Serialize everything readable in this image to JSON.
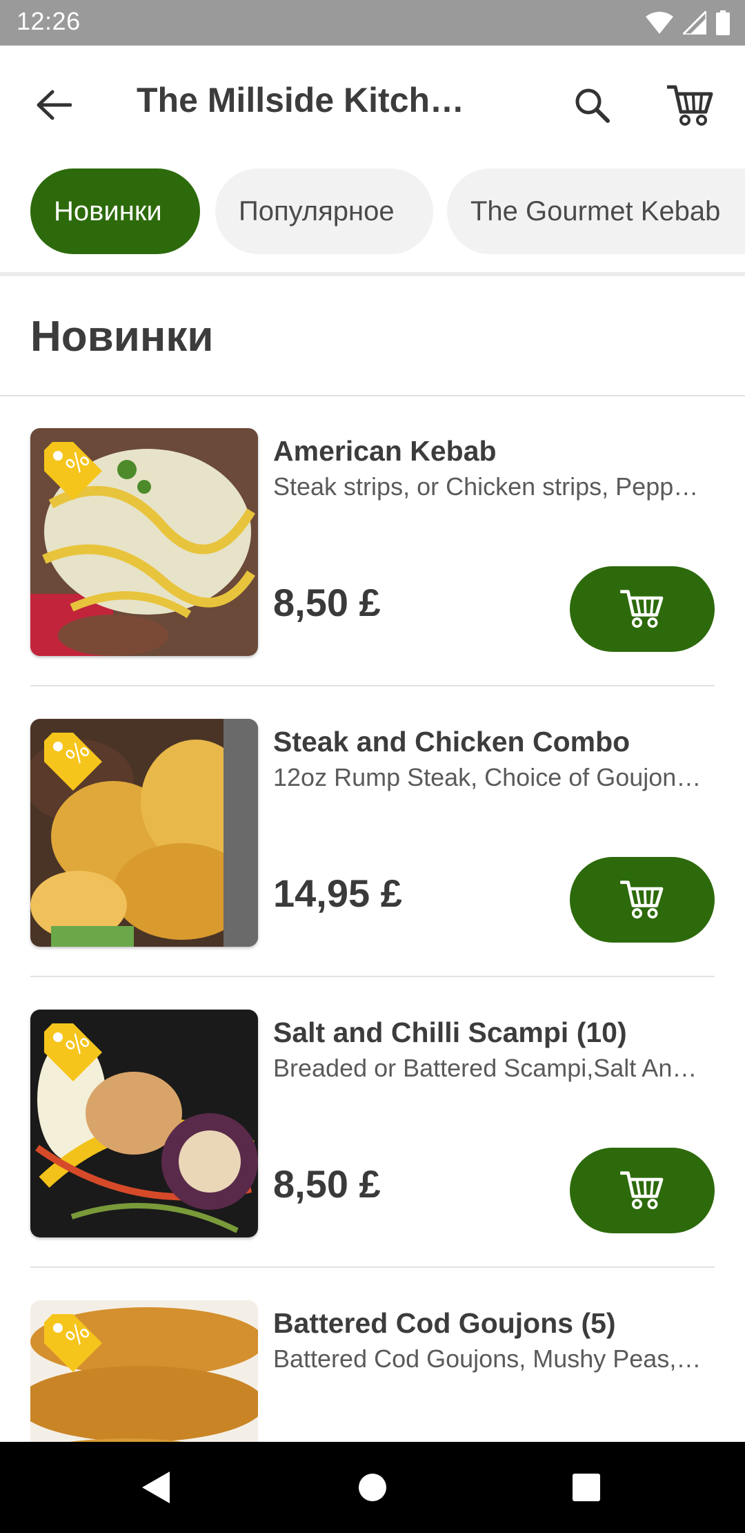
{
  "status_bar": {
    "time": "12:26"
  },
  "app_bar": {
    "title": "The Millside Kitch…"
  },
  "categories": [
    {
      "label": "Новинки",
      "active": true
    },
    {
      "label": "Популярное",
      "active": false
    },
    {
      "label": "The Gourmet  Kebab",
      "active": false
    }
  ],
  "section": {
    "title": "Новинки"
  },
  "items": [
    {
      "name": "American Kebab",
      "description": "Steak strips, or Chicken strips, Pepp…",
      "price": "8,50 £"
    },
    {
      "name": "Steak and Chicken Combo",
      "description": "12oz Rump Steak, Choice of Goujon…",
      "price": "14,95 £"
    },
    {
      "name": "Salt and Chilli  Scampi  (10)",
      "description": "Breaded or Battered Scampi,Salt An…",
      "price": "8,50 £"
    },
    {
      "name": "Battered Cod Goujons  (5)",
      "description": "Battered Cod Goujons, Mushy Peas,…",
      "price": ""
    }
  ],
  "colors": {
    "accent": "#2d6a0b",
    "status_bar": "#9a9a9a",
    "chip_inactive": "#f2f2f2",
    "tag": "#f6c51c"
  },
  "icons": [
    "back-arrow-icon",
    "search-icon",
    "cart-icon",
    "discount-tag-icon",
    "wifi-icon",
    "signal-icon",
    "battery-icon"
  ]
}
